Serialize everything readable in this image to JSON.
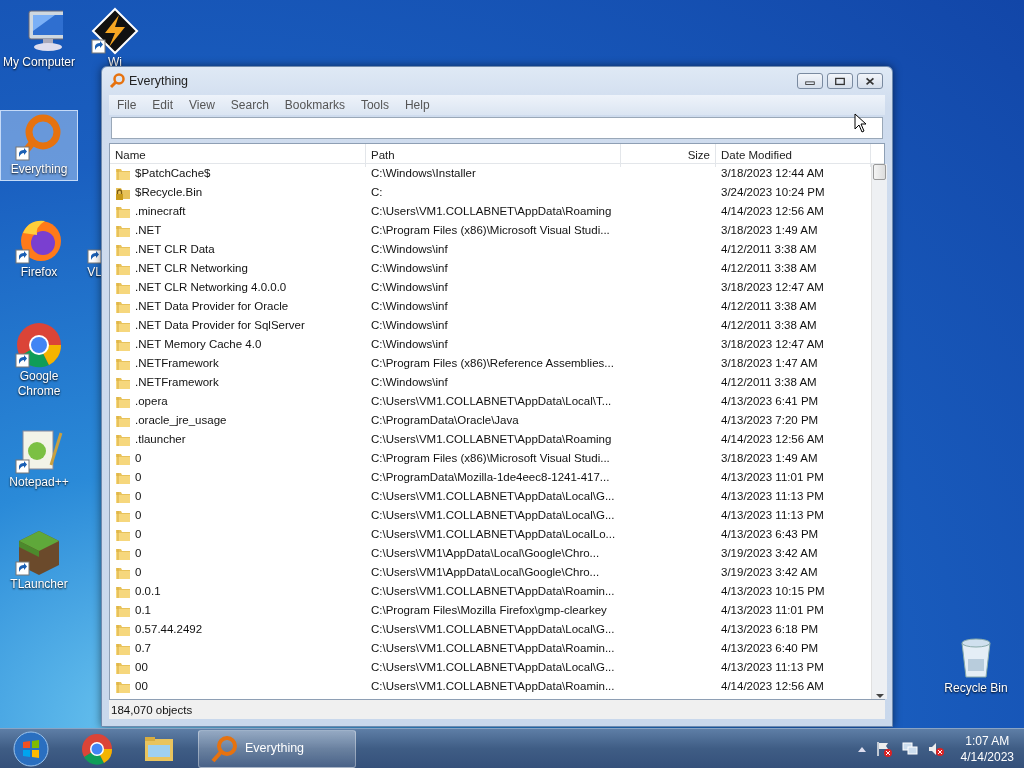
{
  "desktop_icons": [
    {
      "label": "My Computer",
      "kind": "computer",
      "selected": false
    },
    {
      "label": "Wi",
      "kind": "winamp",
      "selected": false
    },
    {
      "label": "Everything",
      "kind": "everything",
      "selected": true
    },
    {
      "label": "Firefox",
      "kind": "firefox",
      "selected": false
    },
    {
      "label": "VL",
      "kind": "shortcut",
      "selected": false
    },
    {
      "label": "Google Chrome",
      "kind": "chrome",
      "selected": false
    },
    {
      "label": "Notepad++",
      "kind": "notepad",
      "selected": false
    },
    {
      "label": "TLauncher",
      "kind": "grass",
      "selected": false
    },
    {
      "label": "Recycle Bin",
      "kind": "bin",
      "selected": false
    }
  ],
  "window": {
    "title": "Everything",
    "menu": [
      "File",
      "Edit",
      "View",
      "Search",
      "Bookmarks",
      "Tools",
      "Help"
    ],
    "columns": [
      "Name",
      "Path",
      "Size",
      "Date Modified"
    ],
    "rows": [
      {
        "name": "$PatchCache$",
        "path": "C:\\Windows\\Installer",
        "modified": "3/18/2023 12:44 AM",
        "kind": "folder"
      },
      {
        "name": "$Recycle.Bin",
        "path": "C:",
        "modified": "3/24/2023 10:24 PM",
        "kind": "locked"
      },
      {
        "name": ".minecraft",
        "path": "C:\\Users\\VM1.COLLABNET\\AppData\\Roaming",
        "modified": "4/14/2023 12:56 AM",
        "kind": "folder"
      },
      {
        "name": ".NET",
        "path": "C:\\Program Files (x86)\\Microsoft Visual Studi...",
        "modified": "3/18/2023 1:49 AM",
        "kind": "folder"
      },
      {
        "name": ".NET CLR Data",
        "path": "C:\\Windows\\inf",
        "modified": "4/12/2011 3:38 AM",
        "kind": "folder"
      },
      {
        "name": ".NET CLR Networking",
        "path": "C:\\Windows\\inf",
        "modified": "4/12/2011 3:38 AM",
        "kind": "folder"
      },
      {
        "name": ".NET CLR Networking 4.0.0.0",
        "path": "C:\\Windows\\inf",
        "modified": "3/18/2023 12:47 AM",
        "kind": "folder"
      },
      {
        "name": ".NET Data Provider for Oracle",
        "path": "C:\\Windows\\inf",
        "modified": "4/12/2011 3:38 AM",
        "kind": "folder"
      },
      {
        "name": ".NET Data Provider for SqlServer",
        "path": "C:\\Windows\\inf",
        "modified": "4/12/2011 3:38 AM",
        "kind": "folder"
      },
      {
        "name": ".NET Memory Cache 4.0",
        "path": "C:\\Windows\\inf",
        "modified": "3/18/2023 12:47 AM",
        "kind": "folder"
      },
      {
        "name": ".NETFramework",
        "path": "C:\\Program Files (x86)\\Reference Assemblies...",
        "modified": "3/18/2023 1:47 AM",
        "kind": "folder"
      },
      {
        "name": ".NETFramework",
        "path": "C:\\Windows\\inf",
        "modified": "4/12/2011 3:38 AM",
        "kind": "folder"
      },
      {
        "name": ".opera",
        "path": "C:\\Users\\VM1.COLLABNET\\AppData\\Local\\T...",
        "modified": "4/13/2023 6:41 PM",
        "kind": "folder"
      },
      {
        "name": ".oracle_jre_usage",
        "path": "C:\\ProgramData\\Oracle\\Java",
        "modified": "4/13/2023 7:20 PM",
        "kind": "folder"
      },
      {
        "name": ".tlauncher",
        "path": "C:\\Users\\VM1.COLLABNET\\AppData\\Roaming",
        "modified": "4/14/2023 12:56 AM",
        "kind": "folder"
      },
      {
        "name": "0",
        "path": "C:\\Program Files (x86)\\Microsoft Visual Studi...",
        "modified": "3/18/2023 1:49 AM",
        "kind": "folder"
      },
      {
        "name": "0",
        "path": "C:\\ProgramData\\Mozilla-1de4eec8-1241-417...",
        "modified": "4/13/2023 11:01 PM",
        "kind": "folder"
      },
      {
        "name": "0",
        "path": "C:\\Users\\VM1.COLLABNET\\AppData\\Local\\G...",
        "modified": "4/13/2023 11:13 PM",
        "kind": "folder"
      },
      {
        "name": "0",
        "path": "C:\\Users\\VM1.COLLABNET\\AppData\\Local\\G...",
        "modified": "4/13/2023 11:13 PM",
        "kind": "folder"
      },
      {
        "name": "0",
        "path": "C:\\Users\\VM1.COLLABNET\\AppData\\LocalLo...",
        "modified": "4/13/2023 6:43 PM",
        "kind": "folder"
      },
      {
        "name": "0",
        "path": "C:\\Users\\VM1\\AppData\\Local\\Google\\Chro...",
        "modified": "3/19/2023 3:42 AM",
        "kind": "folder"
      },
      {
        "name": "0",
        "path": "C:\\Users\\VM1\\AppData\\Local\\Google\\Chro...",
        "modified": "3/19/2023 3:42 AM",
        "kind": "folder"
      },
      {
        "name": "0.0.1",
        "path": "C:\\Users\\VM1.COLLABNET\\AppData\\Roamin...",
        "modified": "4/13/2023 10:15 PM",
        "kind": "folder"
      },
      {
        "name": "0.1",
        "path": "C:\\Program Files\\Mozilla Firefox\\gmp-clearkey",
        "modified": "4/13/2023 11:01 PM",
        "kind": "folder"
      },
      {
        "name": "0.57.44.2492",
        "path": "C:\\Users\\VM1.COLLABNET\\AppData\\Local\\G...",
        "modified": "4/13/2023 6:18 PM",
        "kind": "folder"
      },
      {
        "name": "0.7",
        "path": "C:\\Users\\VM1.COLLABNET\\AppData\\Roamin...",
        "modified": "4/13/2023 6:40 PM",
        "kind": "folder"
      },
      {
        "name": "00",
        "path": "C:\\Users\\VM1.COLLABNET\\AppData\\Local\\G...",
        "modified": "4/13/2023 11:13 PM",
        "kind": "folder"
      },
      {
        "name": "00",
        "path": "C:\\Users\\VM1.COLLABNET\\AppData\\Roamin...",
        "modified": "4/14/2023 12:56 AM",
        "kind": "folder"
      }
    ],
    "status": "184,070 objects"
  },
  "taskbar": {
    "pinned": [
      {
        "kind": "chrome"
      },
      {
        "kind": "explorer"
      }
    ],
    "tasks": [
      {
        "label": "Everything",
        "selected": true
      }
    ],
    "tray": [
      {
        "kind": "flag"
      },
      {
        "kind": "network"
      },
      {
        "kind": "volume"
      }
    ],
    "time": "1:07 AM",
    "date": "4/14/2023"
  }
}
